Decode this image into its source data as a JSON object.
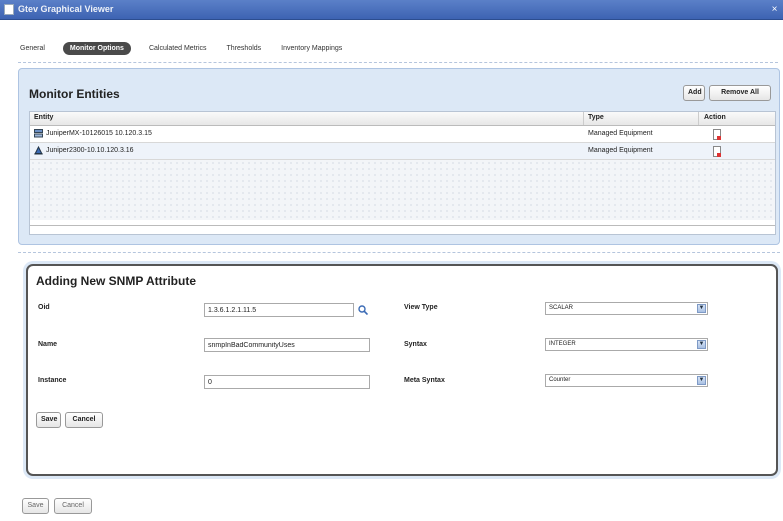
{
  "window": {
    "title": "Gtev Graphical Viewer",
    "close_glyph": "×"
  },
  "tabs": [
    {
      "label": "General"
    },
    {
      "label": "Monitor Options"
    },
    {
      "label": "Calculated Metrics"
    },
    {
      "label": "Thresholds"
    },
    {
      "label": "Inventory Mappings"
    }
  ],
  "monitor": {
    "title": "Monitor Entities",
    "add_label": "Add",
    "remove_all_label": "Remove All",
    "columns": {
      "entity": "Entity",
      "type": "Type",
      "action": "Action"
    },
    "rows": [
      {
        "entity": "JuniperMX-10126015 10.120.3.15",
        "type": "Managed Equipment",
        "icon": "equipment-icon"
      },
      {
        "entity": "Juniper2300-10.10.120.3.16",
        "type": "Managed Equipment",
        "icon": "network-device-icon"
      }
    ]
  },
  "snmp": {
    "title": "Adding New SNMP Attribute",
    "oid_label": "Oid",
    "oid_value": "1.3.6.1.2.1.11.5",
    "name_label": "Name",
    "name_value": "snmpInBadCommunityUses",
    "instance_label": "Instance",
    "instance_value": "0",
    "view_type_label": "View Type",
    "view_type_value": "SCALAR",
    "syntax_label": "Syntax",
    "syntax_value": "INTEGER",
    "meta_syntax_label": "Meta Syntax",
    "meta_syntax_value": "Counter",
    "save_label": "Save",
    "cancel_label": "Cancel",
    "dropdown_glyph": "▼"
  },
  "footer": {
    "save_label": "Save",
    "cancel_label": "Cancel"
  },
  "colors": {
    "titlebar": "#3d63b2",
    "panel_bg": "#dce8f6",
    "active_tab": "#4a4a4a"
  }
}
